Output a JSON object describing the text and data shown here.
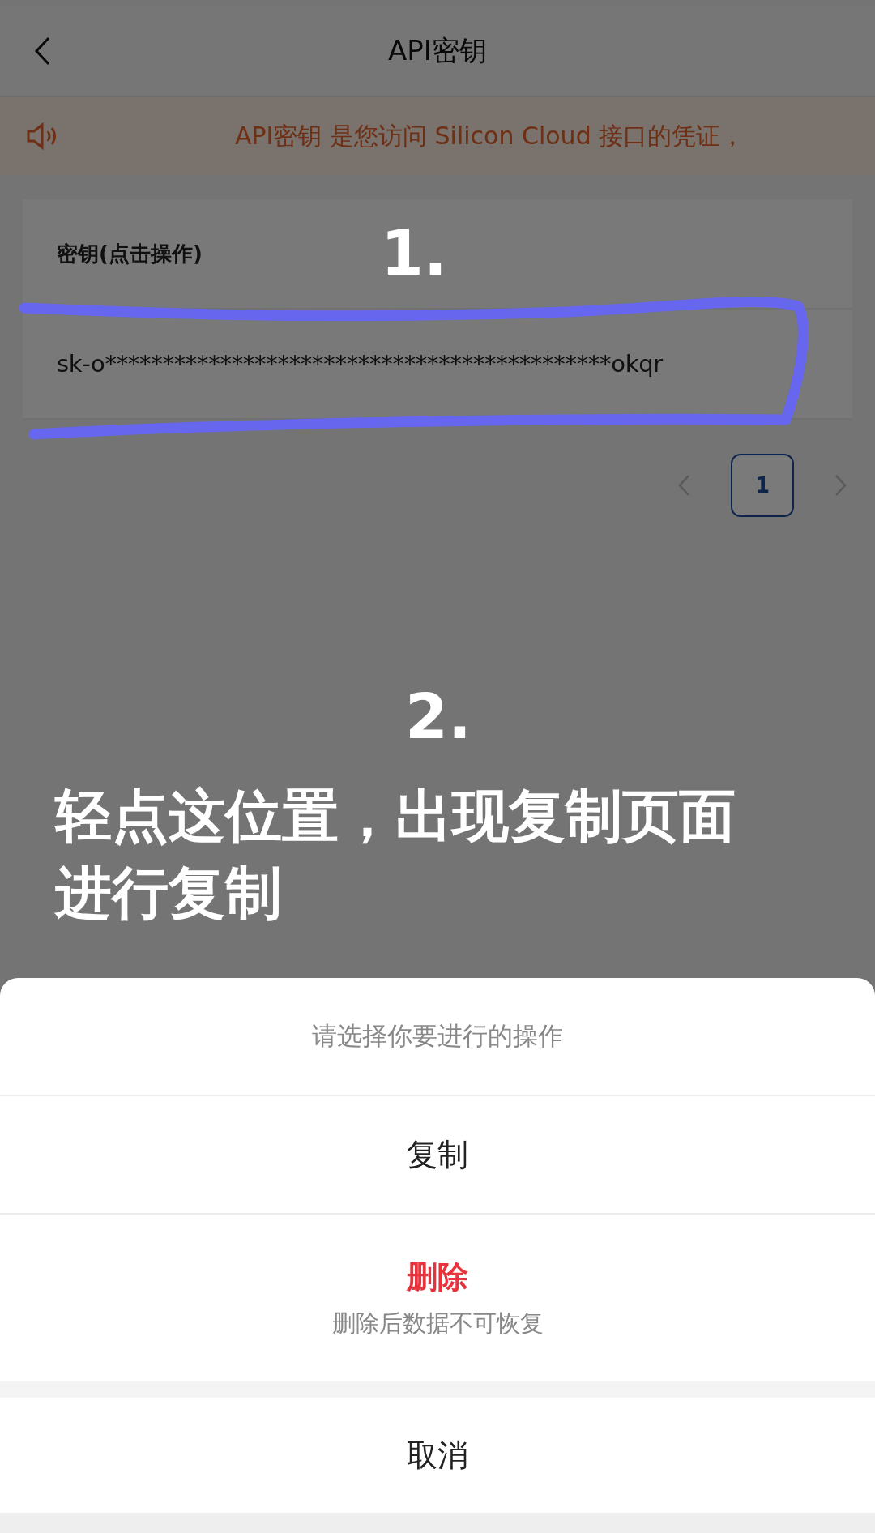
{
  "header": {
    "title": "API密钥"
  },
  "notice": {
    "text": "API密钥 是您访问 Silicon Cloud 接口的凭证，"
  },
  "table": {
    "columns": [
      "密钥(点击操作)"
    ],
    "rows": [
      {
        "key": "sk-o********************************************okqr"
      }
    ]
  },
  "pagination": {
    "pages": [
      {
        "label": "1",
        "selected": true
      }
    ]
  },
  "annotations": [
    {
      "kind": "number",
      "text": "1."
    },
    {
      "kind": "number",
      "text": "2."
    },
    {
      "kind": "instruction",
      "text": "轻点这位置，出现复制页面进行复制"
    }
  ],
  "action_sheet": {
    "title": "请选择你要进行的操作",
    "actions": [
      {
        "label": "复制",
        "kind": "normal"
      },
      {
        "label": "删除",
        "kind": "danger",
        "description": "删除后数据不可恢复"
      }
    ],
    "cancel": "取消"
  }
}
